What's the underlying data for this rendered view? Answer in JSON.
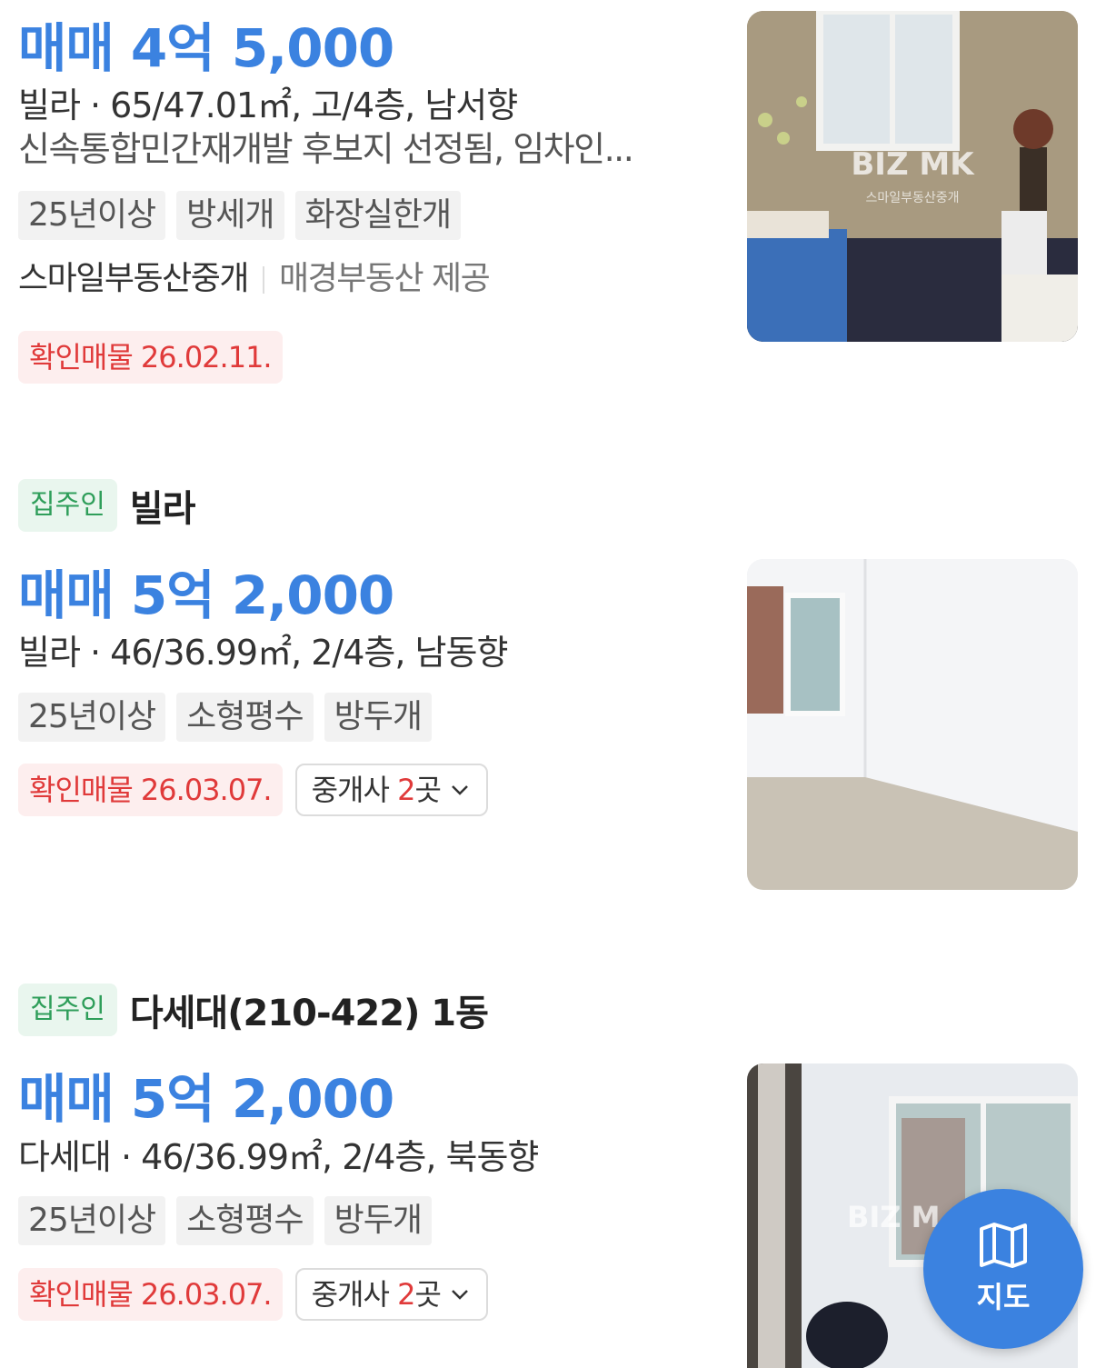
{
  "listings": [
    {
      "price": "매매 4억 5,000",
      "spec": "빌라 · 65/47.01㎡, 고/4층, 남서향",
      "description": "신속통합민간재개발 후보지 선정됨, 임차인...",
      "tags": [
        "25년이상",
        "방세개",
        "화장실한개"
      ],
      "agency": "스마일부동산중개",
      "provider": "매경부동산 제공",
      "verified": "확인매물 26.02.11.",
      "image_watermark": "BIZ MK",
      "image_sub": "스마일부동산중개"
    },
    {
      "owner_badge": "집주인",
      "title": "빌라",
      "price": "매매 5억 2,000",
      "spec": "빌라 · 46/36.99㎡, 2/4층, 남동향",
      "tags": [
        "25년이상",
        "소형평수",
        "방두개"
      ],
      "verified": "확인매물 26.03.07.",
      "broker_prefix": "중개사 ",
      "broker_count": "2",
      "broker_suffix": "곳"
    },
    {
      "owner_badge": "집주인",
      "title": "다세대(210-422) 1동",
      "price": "매매 5억 2,000",
      "spec": "다세대 · 46/36.99㎡, 2/4층, 북동향",
      "tags": [
        "25년이상",
        "소형평수",
        "방두개"
      ],
      "verified": "확인매물 26.03.07.",
      "broker_prefix": "중개사 ",
      "broker_count": "2",
      "broker_suffix": "곳",
      "image_watermark": "BIZ M"
    }
  ],
  "map_button": {
    "label": "지도",
    "icon": "map-icon"
  },
  "colors": {
    "price": "#3b82e0",
    "verified": "#e03a3a",
    "owner": "#2f9e5a"
  }
}
